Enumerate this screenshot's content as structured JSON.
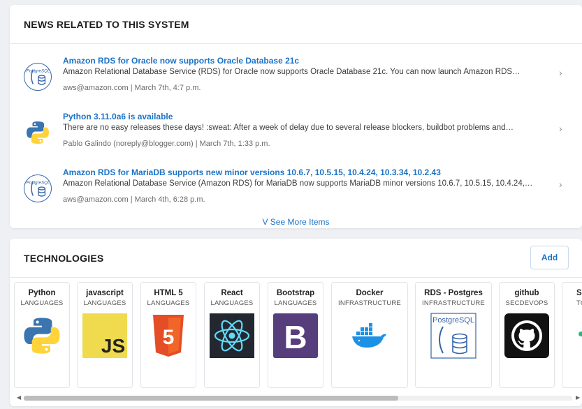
{
  "news": {
    "title": "NEWS RELATED TO THIS SYSTEM",
    "items": [
      {
        "icon": "postgresql-icon",
        "title": "Amazon RDS for Oracle now supports Oracle Database 21c",
        "description": "Amazon Relational Database Service (RDS) for Oracle now supports Oracle Database 21c. You can now launch Amazon RDS…",
        "meta": "aws@amazon.com | March 7th, 4:7 p.m."
      },
      {
        "icon": "python-icon",
        "title": "Python 3.11.0a6 is available",
        "description": "There are no easy releases these days! :sweat: After a week of delay due to several release blockers, buildbot problems and…",
        "meta": "Pablo Galindo (noreply@blogger.com) | March 7th, 1:33 p.m."
      },
      {
        "icon": "postgresql-icon",
        "title": "Amazon RDS for MariaDB supports new minor versions 10.6.7, 10.5.15, 10.4.24, 10.3.34, 10.2.43",
        "description": "Amazon Relational Database Service (Amazon RDS) for MariaDB now supports MariaDB minor versions 10.6.7, 10.5.15, 10.4.24,…",
        "meta": "aws@amazon.com | March 4th, 6:28 p.m."
      }
    ],
    "see_more": "V See More Items"
  },
  "technologies": {
    "title": "TECHNOLOGIES",
    "add_label": "Add",
    "items": [
      {
        "name": "Python",
        "category": "LANGUAGES",
        "icon": "python-icon"
      },
      {
        "name": "javascript",
        "category": "LANGUAGES",
        "icon": "javascript-icon"
      },
      {
        "name": "HTML 5",
        "category": "LANGUAGES",
        "icon": "html5-icon"
      },
      {
        "name": "React",
        "category": "LANGUAGES",
        "icon": "react-icon"
      },
      {
        "name": "Bootstrap",
        "category": "LANGUAGES",
        "icon": "bootstrap-icon"
      },
      {
        "name": "Docker",
        "category": "INFRASTRUCTURE",
        "icon": "docker-icon"
      },
      {
        "name": "RDS - Postgres",
        "category": "INFRASTRUCTURE",
        "icon": "postgresql-icon"
      },
      {
        "name": "github",
        "category": "SECDEVOPS",
        "icon": "github-icon"
      },
      {
        "name": "S",
        "category": "TO",
        "icon": "slack-icon"
      }
    ],
    "logo_text": {
      "postgres_small": "PostgreSQL",
      "js": "JS",
      "bootstrap": "B",
      "html5": "5"
    }
  },
  "colors": {
    "accent": "#1c73c7",
    "python_blue": "#3a75b0",
    "python_yellow": "#ffd43b",
    "js_yellow": "#f0db4f",
    "html_orange": "#e44d26",
    "react_bg": "#23272f",
    "react_cyan": "#61dafb",
    "bootstrap_purple": "#563d7c",
    "docker_blue": "#1d91e6"
  }
}
